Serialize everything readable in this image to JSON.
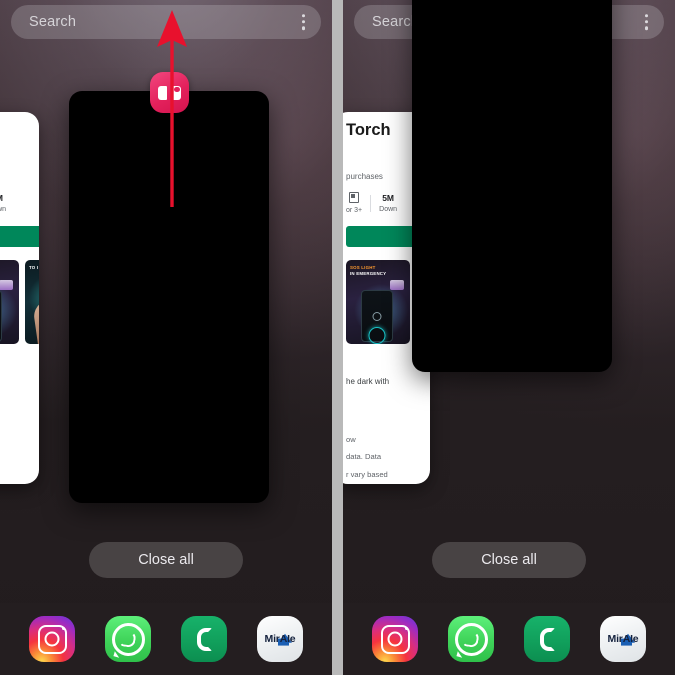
{
  "screen": {
    "title": "Android recents overview — swipe up to close app",
    "background_color": "#241e20",
    "accent_color": "#e3215c",
    "annotation_color": "#e8112d"
  },
  "panels": [
    {
      "id": "before",
      "search": {
        "placeholder": "Search",
        "menu_icon": "kebab-menu-icon"
      },
      "annotation": {
        "type": "swipe-up-arrow",
        "color": "#e8112d",
        "visible": true
      },
      "app_badge": {
        "icon": "app-icon-pink",
        "visible": true
      },
      "app_card": {
        "label": "app-preview-card",
        "state": "being swiped up"
      },
      "close_all": {
        "label": "Close all"
      }
    },
    {
      "id": "after",
      "search": {
        "placeholder": "Search",
        "menu_icon": "kebab-menu-icon"
      },
      "annotation": {
        "type": "swipe-up-arrow",
        "color": "#e8112d",
        "visible": false
      },
      "app_badge": {
        "icon": "app-icon-pink",
        "visible": false
      },
      "app_card": {
        "label": "app-preview-card",
        "state": "moved up off screen"
      },
      "close_all": {
        "label": "Close all"
      }
    }
  ],
  "peek_card": {
    "title": "Torch",
    "purchases": "purchases",
    "rating_label": "or 3+",
    "downloads_value": "5M",
    "downloads_label": "Down",
    "install_label": "",
    "screenshots": [
      {
        "caption_line1": "SOS LIGHT",
        "caption_line2": "IN EMERGENCY"
      },
      {
        "caption_line1": "TO I",
        "caption_line2": ""
      }
    ],
    "arrow_glyph": "→",
    "body_line_1": "he dark with",
    "body_line_2": "ow",
    "body_line_3": "data. Data",
    "body_line_4": "r vary based"
  },
  "dock": {
    "items": [
      {
        "name": "instagram",
        "label": ""
      },
      {
        "name": "whatsapp",
        "label": ""
      },
      {
        "name": "phone",
        "label": ""
      },
      {
        "name": "miraie",
        "label": "MirAIe"
      }
    ]
  }
}
